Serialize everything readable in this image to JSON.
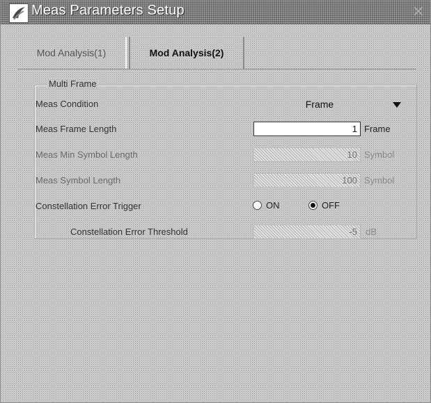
{
  "window": {
    "title": "Meas Parameters Setup",
    "close_glyph": "✕",
    "icon": "app-logo-icon"
  },
  "tabs": [
    {
      "label": "Mod Analysis(1)",
      "selected": false
    },
    {
      "label": "Mod Analysis(2)",
      "selected": true
    }
  ],
  "group": {
    "title": "Multi Frame",
    "rows": {
      "meas_condition": {
        "label": "Meas Condition",
        "value": "Frame"
      },
      "meas_frame_length": {
        "label": "Meas Frame Length",
        "value": "1",
        "unit": "Frame",
        "enabled": true
      },
      "meas_min_symbol_length": {
        "label": "Meas Min Symbol Length",
        "value": "10",
        "unit": "Symbol",
        "enabled": false
      },
      "meas_symbol_length": {
        "label": "Meas Symbol Length",
        "value": "100",
        "unit": "Symbol",
        "enabled": false
      },
      "constellation_error_trigger": {
        "label": "Constellation Error Trigger",
        "options": [
          "ON",
          "OFF"
        ],
        "selected": "OFF"
      },
      "constellation_error_threshold": {
        "label": "Constellation Error Threshold",
        "value": "-5",
        "unit": "dB",
        "enabled": false
      }
    }
  },
  "colors": {
    "title_text": "#ffffff",
    "disabled_text": "#8a8a8a",
    "panel_border": "#a8a8a8"
  }
}
